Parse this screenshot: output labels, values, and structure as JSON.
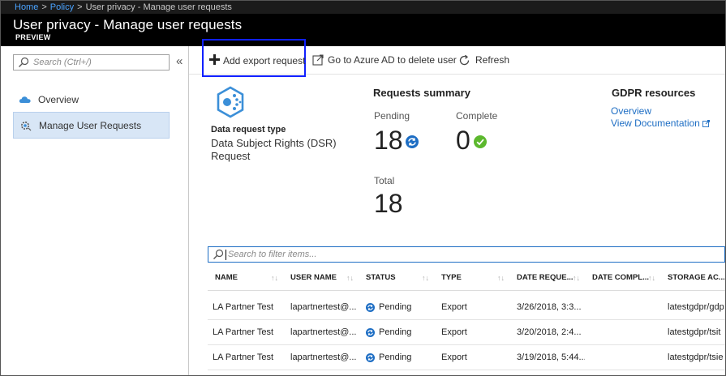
{
  "breadcrumb": {
    "items": [
      "Home",
      "Policy"
    ],
    "current": "User privacy - Manage user requests"
  },
  "header": {
    "title": "User privacy - Manage user requests",
    "badge": "PREVIEW"
  },
  "sidebar": {
    "search_placeholder": "Search (Ctrl+/)",
    "collapse_glyph": "«",
    "items": [
      {
        "label": "Overview",
        "icon": "cloud-icon",
        "selected": false
      },
      {
        "label": "Manage User Requests",
        "icon": "gear-icon",
        "selected": true
      }
    ]
  },
  "toolbar": {
    "add_label": "Add export request",
    "delete_label": "Go to Azure AD to delete user",
    "refresh_label": "Refresh"
  },
  "dsr": {
    "label": "Data request type",
    "value": "Data Subject Rights (DSR) Request"
  },
  "summary": {
    "title": "Requests summary",
    "pending_label": "Pending",
    "pending_value": "18",
    "complete_label": "Complete",
    "complete_value": "0",
    "total_label": "Total",
    "total_value": "18"
  },
  "gdpr": {
    "title": "GDPR resources",
    "overview_link": "Overview",
    "docs_link": "View Documentation"
  },
  "filter": {
    "placeholder": "Search to filter items..."
  },
  "table": {
    "columns": [
      "NAME",
      "USER NAME",
      "STATUS",
      "TYPE",
      "DATE REQUE...",
      "DATE COMPL...",
      "STORAGE AC..."
    ],
    "rows": [
      {
        "name": "LA Partner Test",
        "user": "lapartnertest@...",
        "status": "Pending",
        "type": "Export",
        "date_req": "3/26/2018, 3:3...",
        "date_comp": "",
        "storage": "latestgdpr/gdp"
      },
      {
        "name": "LA Partner Test",
        "user": "lapartnertest@...",
        "status": "Pending",
        "type": "Export",
        "date_req": "3/20/2018, 2:4...",
        "date_comp": "",
        "storage": "latestgdpr/tsit"
      },
      {
        "name": "LA Partner Test",
        "user": "lapartnertest@...",
        "status": "Pending",
        "type": "Export",
        "date_req": "3/19/2018, 5:44...",
        "date_comp": "",
        "storage": "latestgdpr/tsie"
      }
    ]
  },
  "colors": {
    "accent": "#1e6ec4",
    "highlight_box": "#1020ff",
    "success": "#5cb82e",
    "selected_nav": "#d8e6f6"
  }
}
